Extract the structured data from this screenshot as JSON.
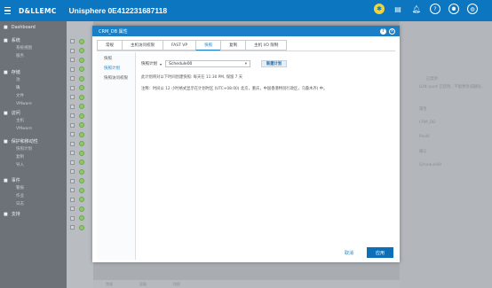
{
  "header": {
    "logo": "D&LLEMC",
    "title": "Unisphere 0E412231687118",
    "icons": [
      "settings-badge-icon",
      "clipboard-icon",
      "bell-icon",
      "help-icon",
      "user-icon",
      "globe-icon"
    ],
    "accent": "#0d76c0"
  },
  "nav": {
    "groups": [
      {
        "icon": "dashboard-icon",
        "label": "Dashboard",
        "items": []
      },
      {
        "icon": "system-icon",
        "label": "系统",
        "items": [
          "系统视图",
          "服务"
        ]
      },
      {
        "icon": "storage-icon",
        "label": "存储",
        "items": [
          "池",
          "块",
          "文件",
          "VMware"
        ]
      },
      {
        "icon": "access-icon",
        "label": "访问",
        "items": [
          "主机",
          "VMware"
        ]
      },
      {
        "icon": "protection-icon",
        "label": "保护和移动性",
        "items": [
          "快照计划",
          "复制",
          "导入"
        ]
      },
      {
        "icon": "events-icon",
        "label": "事件",
        "items": [
          "警报",
          "作业",
          "日志"
        ]
      },
      {
        "icon": "support-icon",
        "label": "支持",
        "items": []
      }
    ]
  },
  "modal": {
    "title": "CRM_DB 属性",
    "tabs": [
      "常规",
      "主机访问权限",
      "FAST VP",
      "快照",
      "复制",
      "主机 I/O 限制"
    ],
    "active_tab": "快照",
    "subnav": [
      "快照",
      "快照计划",
      "快照访问权限"
    ],
    "active_subnav": "快照计划",
    "schedule_label": "快照计划",
    "schedule_value": "Schedule00",
    "new_schedule_button": "新建计划",
    "desc_line": "此计划将对以下时间创建快照:    每天在 11:30 PM, 保留 7 天",
    "note_line": "注释：时间以 12 小时格式显示在计划时区 (UTC+08:00) 北京，重庆，中国香港特别行政区，乌鲁木齐) 中。",
    "cancel_label": "取消",
    "apply_label": "应用"
  },
  "background": {
    "right_texts": [
      "已禁用",
      "LUN sport 已禁用，不能更改或删除。",
      "属性",
      "CRM_DB",
      "Pool0",
      "确认",
      "Schedule00"
    ],
    "bottom_tabs": [
      "常规",
      "容量",
      "快照"
    ]
  }
}
